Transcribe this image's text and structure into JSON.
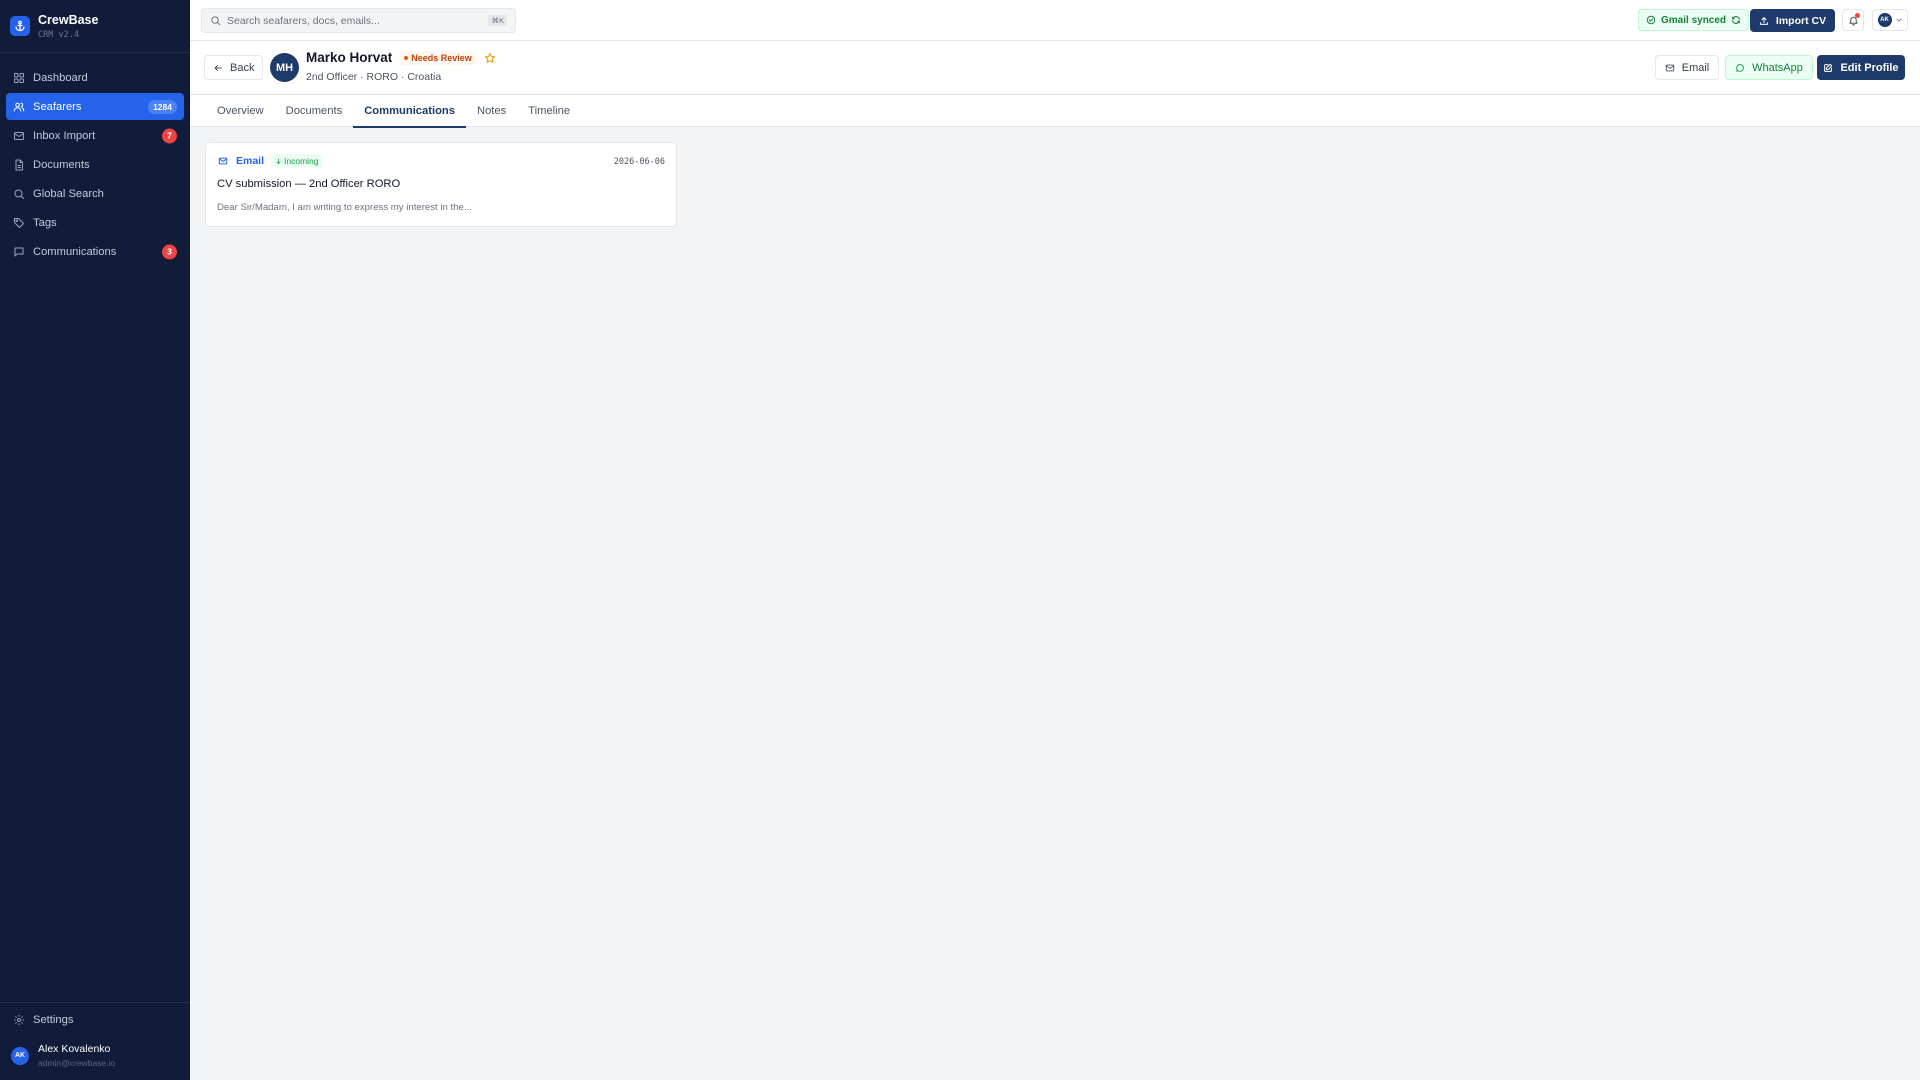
{
  "app": {
    "name": "CrewBase",
    "version": "CRM v2.4"
  },
  "sidebar": {
    "items": [
      {
        "label": "Dashboard",
        "icon": "dashboard-icon"
      },
      {
        "label": "Seafarers",
        "icon": "users-icon",
        "badge": "1284",
        "active": true
      },
      {
        "label": "Inbox Import",
        "icon": "mail-icon",
        "badge": "7"
      },
      {
        "label": "Documents",
        "icon": "document-icon"
      },
      {
        "label": "Global Search",
        "icon": "search-icon"
      },
      {
        "label": "Tags",
        "icon": "tag-icon"
      },
      {
        "label": "Communications",
        "icon": "chat-icon",
        "badge": "3"
      }
    ],
    "settings_label": "Settings",
    "user": {
      "initials": "AK",
      "name": "Alex Kovalenko",
      "email": "admin@crewbase.io"
    }
  },
  "topbar": {
    "search_placeholder": "Search seafarers, docs, emails...",
    "search_shortcut": "⌘K",
    "gmail_status": "Gmail synced",
    "import_label": "Import CV",
    "profile_initials": "AK"
  },
  "profile": {
    "back_label": "Back",
    "initials": "MH",
    "name": "Marko Horvat",
    "status": "Needs Review",
    "subtitle": "2nd Officer · RORO · Croatia",
    "email_label": "Email",
    "whatsapp_label": "WhatsApp",
    "edit_label": "Edit Profile"
  },
  "tabs": [
    {
      "label": "Overview"
    },
    {
      "label": "Documents"
    },
    {
      "label": "Communications",
      "active": true
    },
    {
      "label": "Notes"
    },
    {
      "label": "Timeline"
    }
  ],
  "communications": [
    {
      "type": "Email",
      "direction": "Incoming",
      "date": "2026-06-06",
      "subject": "CV submission — 2nd Officer RORO",
      "snippet": "Dear Sir/Madam, I am writing to express my interest in the..."
    }
  ],
  "colors": {
    "sidebar_bg": "#111c3a",
    "accent": "#2563eb",
    "primary_dark": "#1e3a6b",
    "success": "#16a34a",
    "warning": "#ea580c",
    "danger": "#ef4444"
  }
}
